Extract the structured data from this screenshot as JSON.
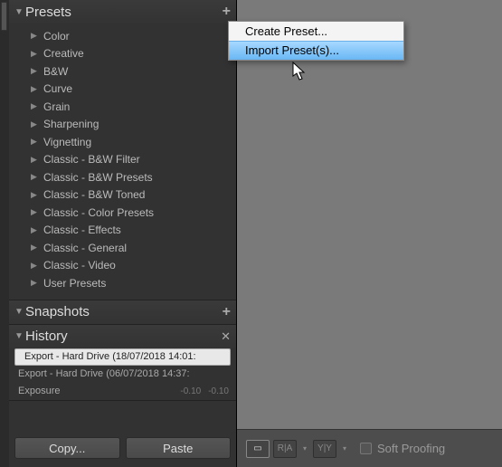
{
  "panels": {
    "presets": {
      "title": "Presets",
      "items": [
        "Color",
        "Creative",
        "B&W",
        "Curve",
        "Grain",
        "Sharpening",
        "Vignetting",
        "Classic - B&W Filter",
        "Classic - B&W Presets",
        "Classic - B&W Toned",
        "Classic - Color Presets",
        "Classic - Effects",
        "Classic - General",
        "Classic - Video",
        "User Presets"
      ]
    },
    "snapshots": {
      "title": "Snapshots"
    },
    "history": {
      "title": "History",
      "rows": [
        {
          "label": "Export - Hard Drive (18/07/2018 14:01:",
          "v1": "",
          "v2": ""
        },
        {
          "label": "Export - Hard Drive (06/07/2018 14:37:",
          "v1": "",
          "v2": ""
        },
        {
          "label": "Exposure",
          "v1": "-0.10",
          "v2": "-0.10"
        }
      ],
      "selected": 0
    }
  },
  "bottom": {
    "copy": "Copy...",
    "paste": "Paste"
  },
  "toolbar": {
    "soft_proofing": "Soft Proofing"
  },
  "context_menu": {
    "create": "Create Preset...",
    "import": "Import Preset(s)..."
  }
}
